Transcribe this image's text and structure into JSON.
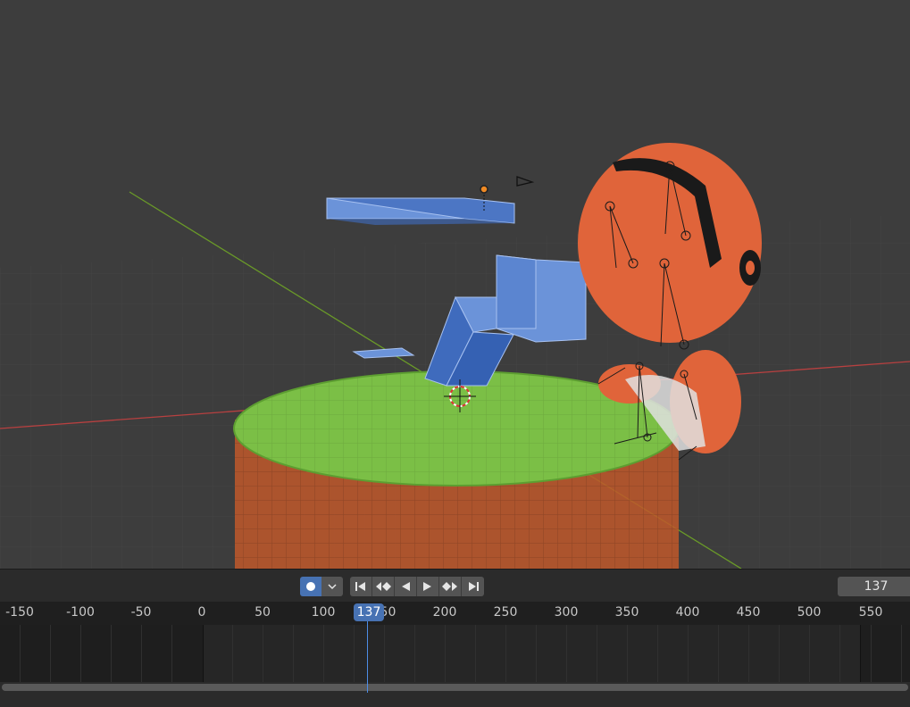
{
  "timeline": {
    "current_frame": "137",
    "current_frame_value": 137,
    "ruler_ticks": [
      "-150",
      "-100",
      "-50",
      "0",
      "50",
      "100",
      "150",
      "200",
      "250",
      "300",
      "350",
      "400",
      "450",
      "500",
      "550"
    ],
    "buttons": {
      "record": "record-keyframes",
      "keying": "keying-options",
      "jump_start": "jump-to-start",
      "prev_keyframe": "jump-to-previous-keyframe",
      "play_reverse": "play-reverse",
      "play": "play",
      "next_keyframe": "jump-to-next-keyframe",
      "jump_end": "jump-to-end"
    }
  },
  "colors": {
    "viewport_bg": "#3d3d3d",
    "accent": "#4772b3",
    "x_axis": "#c24141",
    "y_axis": "#6a9a28",
    "selected_mesh": "#5b87d6",
    "ground_disc": "#7bbf46",
    "character": "#e0643a"
  }
}
